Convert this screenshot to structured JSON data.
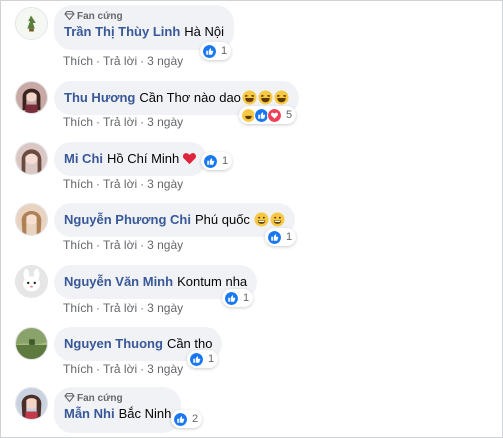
{
  "fan_label": "Fan cứng",
  "actions": {
    "like": "Thích",
    "reply": "Trả lời",
    "separator": "·"
  },
  "comments": [
    {
      "name": "Trần Thị Thùy Linh",
      "text": "Hà Nội",
      "time": "3 ngày",
      "reaction_count": "1",
      "fan": true
    },
    {
      "name": "Thu Hương",
      "text": "Cần Thơ nào dao",
      "time": "3 ngày",
      "reaction_count": "5",
      "fan": false
    },
    {
      "name": "Mi Chi",
      "text": "Hồ Chí Minh",
      "time": "3 ngày",
      "reaction_count": "1",
      "fan": false
    },
    {
      "name": "Nguyễn Phương Chi",
      "text": "Phú quốc",
      "time": "3 ngày",
      "reaction_count": "1",
      "fan": false
    },
    {
      "name": "Nguyễn Văn Minh",
      "text": "Kontum nha",
      "time": "3 ngày",
      "reaction_count": "1",
      "fan": false
    },
    {
      "name": "Nguyen Thuong",
      "text": "Cần tho",
      "time": "3 ngày",
      "reaction_count": "1",
      "fan": false
    },
    {
      "name": "Mẫn Nhi",
      "text": "Bắc Ninh",
      "time": "",
      "reaction_count": "2",
      "fan": true
    }
  ],
  "colors": {
    "name": "#385898",
    "bubble": "#f0f2f5",
    "meta": "#65676b",
    "like": "#1877f2"
  },
  "icons": {
    "like": "like-reaction-icon",
    "haha": "haha-reaction-icon",
    "love": "love-reaction-icon",
    "heart": "red-heart-emoji",
    "fan": "diamond-icon"
  }
}
